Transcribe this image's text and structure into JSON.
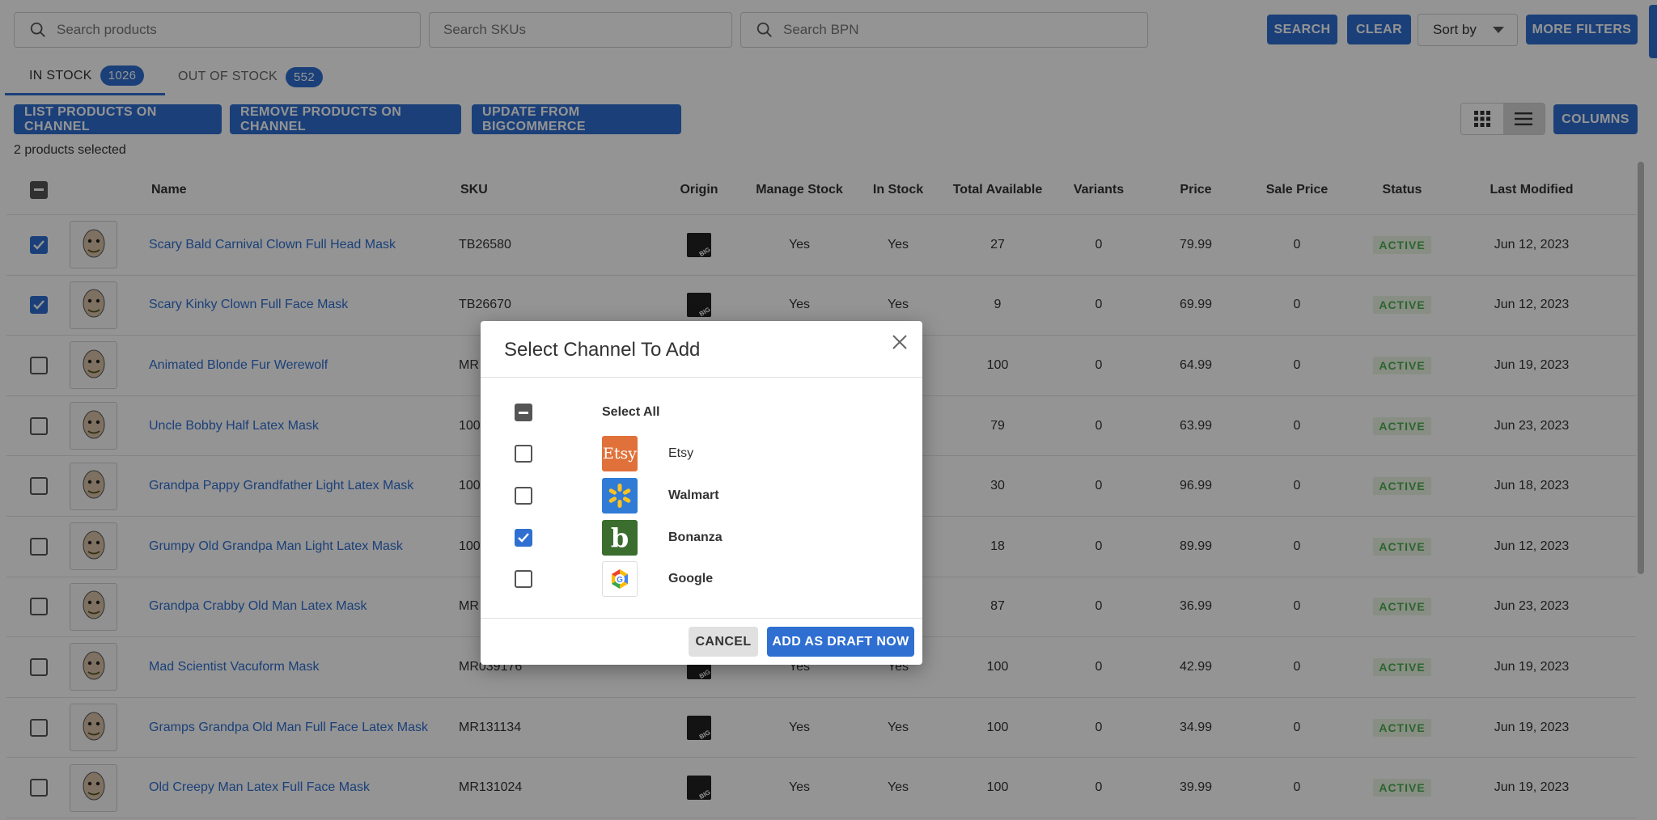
{
  "search": {
    "products_placeholder": "Search products",
    "skus_placeholder": "Search SKUs",
    "bpn_placeholder": "Search BPN",
    "search_label": "SEARCH",
    "clear_label": "CLEAR",
    "sort_label": "Sort by",
    "more_filters_label": "MORE FILTERS"
  },
  "tabs": [
    {
      "label": "IN STOCK",
      "count": "1026",
      "active": true
    },
    {
      "label": "OUT OF STOCK",
      "count": "552",
      "active": false
    }
  ],
  "actions": {
    "list_label": "LIST PRODUCTS ON CHANNEL",
    "remove_label": "REMOVE PRODUCTS ON CHANNEL",
    "update_label": "UPDATE FROM BIGCOMMERCE",
    "columns_label": "COLUMNS"
  },
  "selected_text": "2 products selected",
  "columns": [
    "Name",
    "SKU",
    "Origin",
    "Manage Stock",
    "In Stock",
    "Total Available",
    "Variants",
    "Price",
    "Sale Price",
    "Status",
    "Last Modified"
  ],
  "rows": [
    {
      "checked": true,
      "name": "Scary Bald Carnival Clown Full Head Mask",
      "sku": "TB26580",
      "manage": "Yes",
      "instock": "Yes",
      "total": "27",
      "variants": "0",
      "price": "79.99",
      "sale": "0",
      "status": "ACTIVE",
      "modified": "Jun 12, 2023"
    },
    {
      "checked": true,
      "name": "Scary Kinky Clown Full Face Mask",
      "sku": "TB26670",
      "manage": "Yes",
      "instock": "Yes",
      "total": "9",
      "variants": "0",
      "price": "69.99",
      "sale": "0",
      "status": "ACTIVE",
      "modified": "Jun 12, 2023"
    },
    {
      "checked": false,
      "name": "Animated Blonde Fur Werewolf",
      "sku": "MR",
      "manage": "",
      "instock": "",
      "total": "100",
      "variants": "0",
      "price": "64.99",
      "sale": "0",
      "status": "ACTIVE",
      "modified": "Jun 19, 2023"
    },
    {
      "checked": false,
      "name": "Uncle Bobby Half Latex Mask",
      "sku": "100",
      "manage": "",
      "instock": "",
      "total": "79",
      "variants": "0",
      "price": "63.99",
      "sale": "0",
      "status": "ACTIVE",
      "modified": "Jun 23, 2023"
    },
    {
      "checked": false,
      "name": "Grandpa Pappy Grandfather Light Latex Mask",
      "sku": "100",
      "manage": "",
      "instock": "",
      "total": "30",
      "variants": "0",
      "price": "96.99",
      "sale": "0",
      "status": "ACTIVE",
      "modified": "Jun 18, 2023"
    },
    {
      "checked": false,
      "name": "Grumpy Old Grandpa Man Light Latex Mask",
      "sku": "100",
      "manage": "",
      "instock": "",
      "total": "18",
      "variants": "0",
      "price": "89.99",
      "sale": "0",
      "status": "ACTIVE",
      "modified": "Jun 12, 2023"
    },
    {
      "checked": false,
      "name": "Grandpa Crabby Old Man Latex Mask",
      "sku": "MR",
      "manage": "",
      "instock": "",
      "total": "87",
      "variants": "0",
      "price": "36.99",
      "sale": "0",
      "status": "ACTIVE",
      "modified": "Jun 23, 2023"
    },
    {
      "checked": false,
      "name": "Mad Scientist Vacuform Mask",
      "sku": "MR039176",
      "manage": "Yes",
      "instock": "Yes",
      "total": "100",
      "variants": "0",
      "price": "42.99",
      "sale": "0",
      "status": "ACTIVE",
      "modified": "Jun 19, 2023"
    },
    {
      "checked": false,
      "name": "Gramps Grandpa Old Man Full Face Latex Mask",
      "sku": "MR131134",
      "manage": "Yes",
      "instock": "Yes",
      "total": "100",
      "variants": "0",
      "price": "34.99",
      "sale": "0",
      "status": "ACTIVE",
      "modified": "Jun 19, 2023"
    },
    {
      "checked": false,
      "name": "Old Creepy Man Latex Full Face Mask",
      "sku": "MR131024",
      "manage": "Yes",
      "instock": "Yes",
      "total": "100",
      "variants": "0",
      "price": "39.99",
      "sale": "0",
      "status": "ACTIVE",
      "modified": "Jun 19, 2023"
    }
  ],
  "modal": {
    "title": "Select Channel To Add",
    "select_all_label": "Select All",
    "channels": [
      {
        "label": "Etsy",
        "checked": false,
        "logo_text": "Etsy",
        "color": "#e0713a"
      },
      {
        "label": "Walmart",
        "checked": false,
        "logo_text": "",
        "color": "#2f7bd6"
      },
      {
        "label": "Bonanza",
        "checked": true,
        "logo_text": "b",
        "color": "#3b6d2e"
      },
      {
        "label": "Google",
        "checked": false,
        "logo_text": "",
        "color": "#ffffff"
      }
    ],
    "cancel_label": "CANCEL",
    "add_label": "ADD AS DRAFT NOW"
  },
  "colors": {
    "accent": "#2f6fd1",
    "status_active": "#4caf50"
  }
}
